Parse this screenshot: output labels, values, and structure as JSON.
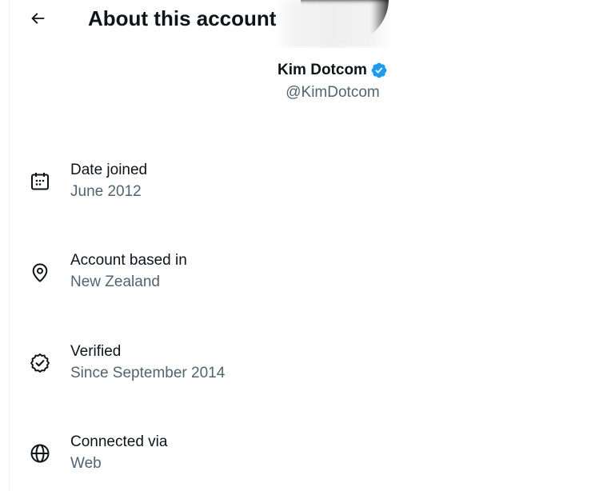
{
  "header": {
    "title": "About this account",
    "back_icon": "arrow-left-icon"
  },
  "profile": {
    "display_name": "Kim Dotcom",
    "handle": "@KimDotcom",
    "verified_icon": "verified-badge-icon",
    "verified_color": "#1d9bf0"
  },
  "info": [
    {
      "icon": "calendar-icon",
      "label": "Date joined",
      "value": "June 2012"
    },
    {
      "icon": "location-pin-icon",
      "label": "Account based in",
      "value": "New Zealand"
    },
    {
      "icon": "verified-check-icon",
      "label": "Verified",
      "value": "Since September 2014"
    },
    {
      "icon": "globe-icon",
      "label": "Connected via",
      "value": "Web"
    }
  ],
  "colors": {
    "text_primary": "#0f1419",
    "text_secondary": "#536471",
    "accent": "#1d9bf0"
  }
}
